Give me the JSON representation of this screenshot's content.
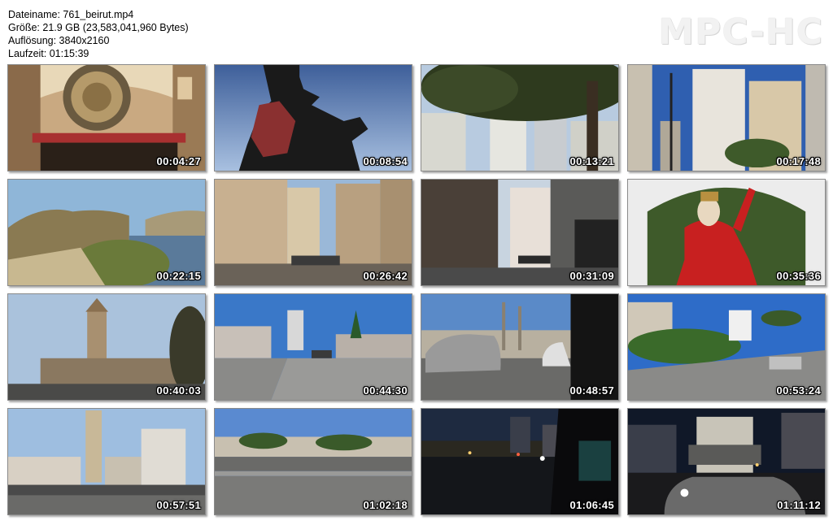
{
  "info": {
    "filename": "Dateiname: 761_beirut.mp4",
    "size": "Größe: 21.9 GB (23,583,041,960 Bytes)",
    "resolution": "Auflösung: 3840x2160",
    "duration": "Laufzeit: 01:15:39"
  },
  "brand": "MPC-HC",
  "thumbnails": [
    {
      "time": "00:04:27",
      "icon": "mosque-interior"
    },
    {
      "time": "00:08:54",
      "icon": "martyrs-statue"
    },
    {
      "time": "00:13:21",
      "icon": "tree-and-towers"
    },
    {
      "time": "00:17:48",
      "icon": "highrise-street"
    },
    {
      "time": "00:22:15",
      "icon": "coastal-rocks"
    },
    {
      "time": "00:26:42",
      "icon": "old-town-street"
    },
    {
      "time": "00:31:09",
      "icon": "narrow-street"
    },
    {
      "time": "00:35:36",
      "icon": "saint-statue"
    },
    {
      "time": "00:40:03",
      "icon": "church-tower"
    },
    {
      "time": "00:44:30",
      "icon": "road-bridge"
    },
    {
      "time": "00:48:57",
      "icon": "car-traffic"
    },
    {
      "time": "00:53:24",
      "icon": "tree-lined-road"
    },
    {
      "time": "00:57:51",
      "icon": "clock-tower"
    },
    {
      "time": "01:02:18",
      "icon": "highway-view"
    },
    {
      "time": "01:06:45",
      "icon": "night-highway"
    },
    {
      "time": "01:11:12",
      "icon": "night-street"
    }
  ]
}
